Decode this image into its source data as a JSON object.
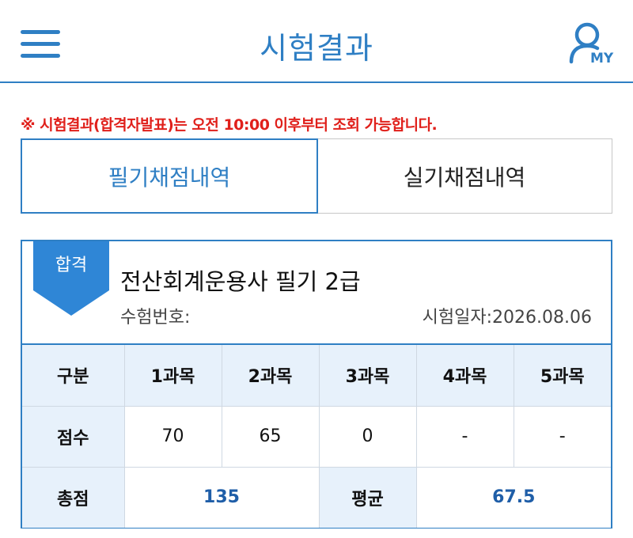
{
  "header": {
    "title": "시험결과",
    "menu_icon": "hamburger-menu-icon",
    "my_icon": "user-icon",
    "my_label": "MY"
  },
  "notice": "※ 시험결과(합격자발표)는 오전 10:00 이후부터 조회 가능합니다.",
  "tabs": [
    {
      "label": "필기채점내역",
      "active": true
    },
    {
      "label": "실기채점내역",
      "active": false
    }
  ],
  "result": {
    "badge": "합격",
    "exam_name": "전산회계운용사 필기 2급",
    "exam_number_label": "수험번호:",
    "exam_date_label": "시험일자:2026.08.06"
  },
  "score_table": {
    "header": [
      "구분",
      "1과목",
      "2과목",
      "3과목",
      "4과목",
      "5과목"
    ],
    "scores_label": "점수",
    "scores": [
      "70",
      "65",
      "0",
      "-",
      "-"
    ],
    "total_label": "총점",
    "total": "135",
    "average_label": "평균",
    "average": "67.5"
  },
  "colors": {
    "accent": "#2f7fc4",
    "notice": "#e0201b",
    "header_cell": "#e7f1fb",
    "value_blue": "#1f5ea8"
  }
}
